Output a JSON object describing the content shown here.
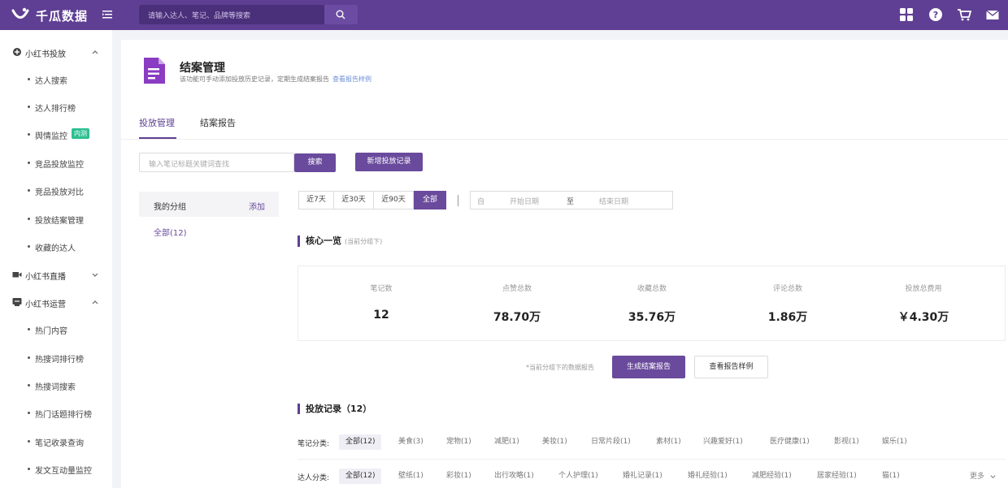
{
  "header": {
    "brand": "千瓜数据",
    "search_placeholder": "请输入达人、笔记、品牌等搜索",
    "colors": {
      "topbar": "#5f3f93",
      "accent": "#6a4a9c",
      "tag_green": "#2bbf8f"
    },
    "icons": [
      "logo-icon",
      "menu-toggle-icon",
      "search-icon",
      "apps-icon",
      "help-icon",
      "cart-icon",
      "mail-icon"
    ]
  },
  "sidebar": {
    "groups": [
      {
        "label": "小红书投放",
        "icon": "delivery-icon",
        "expanded": true
      },
      {
        "label": "小红书直播",
        "icon": "video-icon",
        "expanded": false
      },
      {
        "label": "小红书运营",
        "icon": "operate-icon",
        "expanded": true
      }
    ],
    "items": [
      {
        "label": "达人搜索"
      },
      {
        "label": "达人排行榜"
      },
      {
        "label": "舆情监控",
        "tag": "内测"
      },
      {
        "label": "竞品投放监控"
      },
      {
        "label": "竞品投放对比"
      },
      {
        "label": "投放结案管理"
      },
      {
        "label": "收藏的达人"
      },
      {
        "label": "热门内容"
      },
      {
        "label": "热搜词排行榜"
      },
      {
        "label": "热搜词搜索"
      },
      {
        "label": "热门话题排行榜"
      },
      {
        "label": "笔记收录查询"
      },
      {
        "label": "发文互动量监控"
      }
    ]
  },
  "page": {
    "title": "结案管理",
    "description": "该功能可手动添加投放历史记录，定期生成结案报告",
    "sample_link": "查看报告样例",
    "tabs": [
      {
        "label": "投放管理",
        "active": true
      },
      {
        "label": "结案报告",
        "active": false
      }
    ],
    "keyword_placeholder": "输入笔记标题关键词查找",
    "search_button": "搜索",
    "add_record_button": "新增投放记录",
    "groups": {
      "title": "我的分组",
      "add": "添加",
      "all": "全部(12)"
    },
    "ranges": [
      {
        "label": "近7天"
      },
      {
        "label": "近30天"
      },
      {
        "label": "近90天"
      },
      {
        "label": "全部",
        "active": true
      }
    ],
    "date_prefix": "自",
    "date_start": "开始日期",
    "date_to": "至",
    "date_end": "结束日期",
    "overview_title": "核心一览",
    "overview_note": "(当前分组下)",
    "stats": [
      {
        "label": "笔记数",
        "value": "12"
      },
      {
        "label": "点赞总数",
        "value": "78.70万"
      },
      {
        "label": "收藏总数",
        "value": "35.76万"
      },
      {
        "label": "评论总数",
        "value": "1.86万"
      },
      {
        "label": "投放总费用",
        "value": "￥4.30万"
      }
    ],
    "hint": "*当前分组下的数据报告",
    "generate_button": "生成结案报告",
    "view_sample_button": "查看报告样例",
    "records_title": "投放记录（12）",
    "note_category_label": "笔记分类:",
    "note_categories": [
      "全部(12)",
      "美食(3)",
      "宠物(1)",
      "减肥(1)",
      "美妆(1)",
      "日常片段(1)",
      "素材(1)",
      "兴趣爱好(1)",
      "医疗健康(1)",
      "影视(1)",
      "娱乐(1)"
    ],
    "kol_category_label": "达人分类:",
    "kol_categories": [
      "全部(12)",
      "壁纸(1)",
      "彩妆(1)",
      "出行攻略(1)",
      "个人护理(1)",
      "婚礼记录(1)",
      "婚礼经验(1)",
      "减肥经验(1)",
      "居家经验(1)",
      "猫(1)"
    ],
    "more": "更多"
  }
}
